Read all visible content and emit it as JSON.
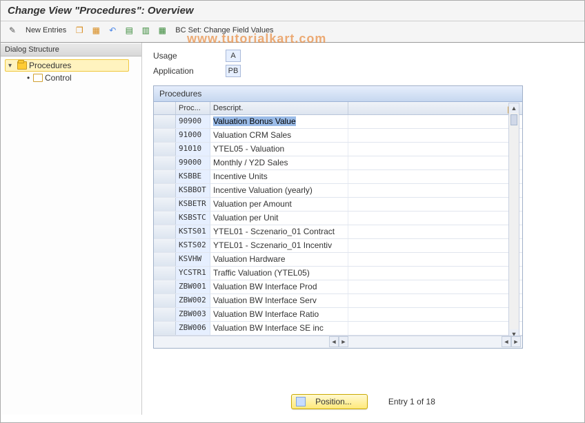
{
  "header": {
    "title": "Change View \"Procedures\": Overview"
  },
  "toolbar": {
    "new_entries": "New Entries",
    "bc_set_label": "BC Set: Change Field Values"
  },
  "watermark": "www.tutorialkart.com",
  "sidebar": {
    "header": "Dialog Structure",
    "root": {
      "label": "Procedures"
    },
    "child": {
      "label": "Control"
    }
  },
  "fields": {
    "usage_label": "Usage",
    "usage_value": "A",
    "application_label": "Application",
    "application_value": "PB"
  },
  "grid": {
    "title": "Procedures",
    "col_proc": "Proc...",
    "col_desc": "Descript.",
    "rows": [
      {
        "proc": "90900",
        "desc": "Valuation Bonus Value"
      },
      {
        "proc": "91000",
        "desc": "Valuation CRM Sales"
      },
      {
        "proc": "91010",
        "desc": "YTEL05 - Valuation"
      },
      {
        "proc": "99000",
        "desc": "Monthly / Y2D Sales"
      },
      {
        "proc": "KSBBE",
        "desc": "Incentive Units"
      },
      {
        "proc": "KSBBOT",
        "desc": "Incentive Valuation (yearly)"
      },
      {
        "proc": "KSBETR",
        "desc": "Valuation per Amount"
      },
      {
        "proc": "KSBSTC",
        "desc": "Valuation per Unit"
      },
      {
        "proc": "KSTS01",
        "desc": "YTEL01 - Sczenario_01 Contract"
      },
      {
        "proc": "KSTS02",
        "desc": "YTEL01 - Sczenario_01 Incentiv"
      },
      {
        "proc": "KSVHW",
        "desc": "Valuation Hardware"
      },
      {
        "proc": "YCSTR1",
        "desc": "Traffic Valuation (YTEL05)"
      },
      {
        "proc": "ZBW001",
        "desc": "Valuation BW Interface Prod"
      },
      {
        "proc": "ZBW002",
        "desc": "Valuation BW Interface Serv"
      },
      {
        "proc": "ZBW003",
        "desc": "Valuation BW Interface Ratio"
      },
      {
        "proc": "ZBW006",
        "desc": "Valuation BW Interface SE inc"
      }
    ]
  },
  "footer": {
    "position_label": "Position...",
    "entry_text": "Entry 1 of 18"
  }
}
